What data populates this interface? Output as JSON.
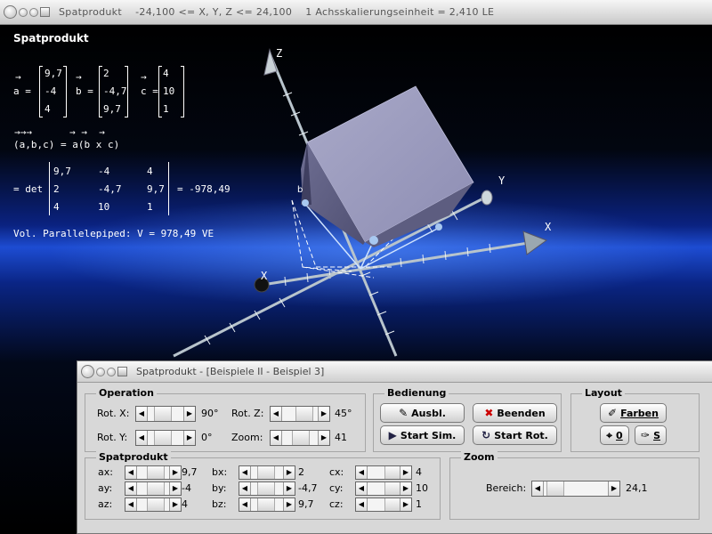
{
  "main_window": {
    "title": "Spatprodukt    -24,100 <= X, Y, Z <= 24,100    1 Achsskalierungseinheit = 2,410 LE"
  },
  "overlay": {
    "heading": "Spatprodukt",
    "vec_arrow": "→",
    "triple_arrows": "→→→",
    "double_arrows": "→ →  →",
    "a_label": "a =",
    "b_label": "b =",
    "c_label": "c =",
    "a": [
      "9,7",
      "-4",
      "4"
    ],
    "b": [
      "2",
      "-4,7",
      "9,7"
    ],
    "c": [
      "4",
      "10",
      "1"
    ],
    "triple_expr": "(a,b,c) = a(b x c)",
    "det_label": "= det",
    "det_rows": [
      [
        "9,7",
        "-4",
        "4"
      ],
      [
        "2",
        "-4,7",
        "9,7"
      ],
      [
        "4",
        "10",
        "1"
      ]
    ],
    "det_result": "= -978,49",
    "volume": "Vol. Parallelepiped: V = 978,49 VE"
  },
  "axes": {
    "x": "X",
    "y": "Y",
    "z": "Z",
    "x_neg": "X"
  },
  "control_window": {
    "title": "Spatprodukt - [Beispiele II - Beispiel 3]",
    "operation": {
      "title": "Operation",
      "rot_x_label": "Rot. X:",
      "rot_x_value": "90°",
      "rot_y_label": "Rot. Y:",
      "rot_y_value": "0°",
      "rot_z_label": "Rot. Z:",
      "rot_z_value": "45°",
      "zoom_label": "Zoom:",
      "zoom_value": "41"
    },
    "bedienung": {
      "title": "Bedienung",
      "ausbl": "Ausbl.",
      "beenden": "Beenden",
      "start_sim": "Start Sim.",
      "start_rot": "Start Rot."
    },
    "layout": {
      "title": "Layout",
      "farben": "Farben",
      "null_btn": "0",
      "s_btn": "S"
    },
    "spatprodukt": {
      "title": "Spatprodukt",
      "rows": [
        {
          "a_label": "ax:",
          "a_val": "9,7",
          "b_label": "bx:",
          "b_val": "2",
          "c_label": "cx:",
          "c_val": "4"
        },
        {
          "a_label": "ay:",
          "a_val": "-4",
          "b_label": "by:",
          "b_val": "-4,7",
          "c_label": "cy:",
          "c_val": "10"
        },
        {
          "a_label": "az:",
          "a_val": "4",
          "b_label": "bz:",
          "b_val": "9,7",
          "c_label": "cz:",
          "c_val": "1"
        }
      ]
    },
    "zoom": {
      "title": "Zoom",
      "bereich_label": "Bereich:",
      "bereich_value": "24,1"
    }
  }
}
